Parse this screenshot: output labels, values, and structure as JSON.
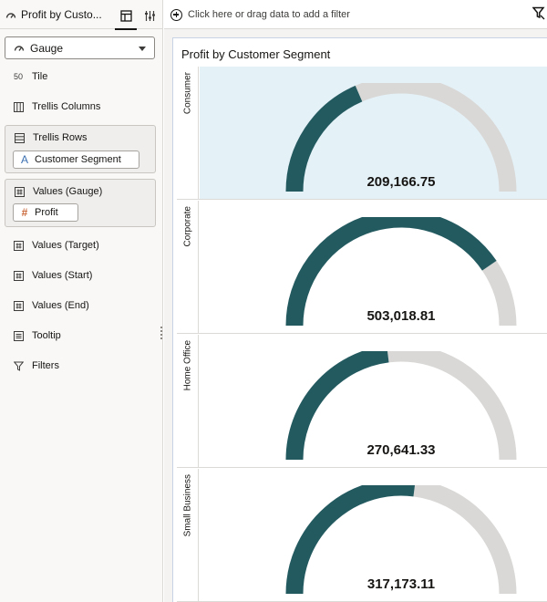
{
  "panel": {
    "tab_title": "Profit by Custo...",
    "viz_type": "Gauge",
    "sections": {
      "tile": "Tile",
      "trellis_columns": "Trellis Columns",
      "trellis_rows": "Trellis Rows",
      "trellis_rows_field": "Customer Segment",
      "values_gauge": "Values (Gauge)",
      "values_gauge_field": "Profit",
      "values_target": "Values (Target)",
      "values_start": "Values (Start)",
      "values_end": "Values (End)",
      "tooltip": "Tooltip",
      "filters": "Filters"
    },
    "tile_icon_text": "50"
  },
  "filterbar": {
    "placeholder": "Click here or drag data to add a filter"
  },
  "viz": {
    "title": "Profit by Customer Segment"
  },
  "colors": {
    "gauge_fill": "#235a60",
    "gauge_track": "#d9d8d6",
    "selected_row": "#e4f1f7"
  },
  "chart_data": {
    "type": "gauge",
    "title": "Profit by Customer Segment",
    "categories": [
      "Consumer",
      "Corporate",
      "Home Office",
      "Small Business"
    ],
    "values": [
      209166.75,
      503018.81,
      270641.33,
      317173.11
    ],
    "value_labels": [
      "209,166.75",
      "503,018.81",
      "270,641.33",
      "317,173.11"
    ],
    "fill_fraction": [
      0.37,
      0.81,
      0.46,
      0.54
    ],
    "selected": "Consumer"
  }
}
